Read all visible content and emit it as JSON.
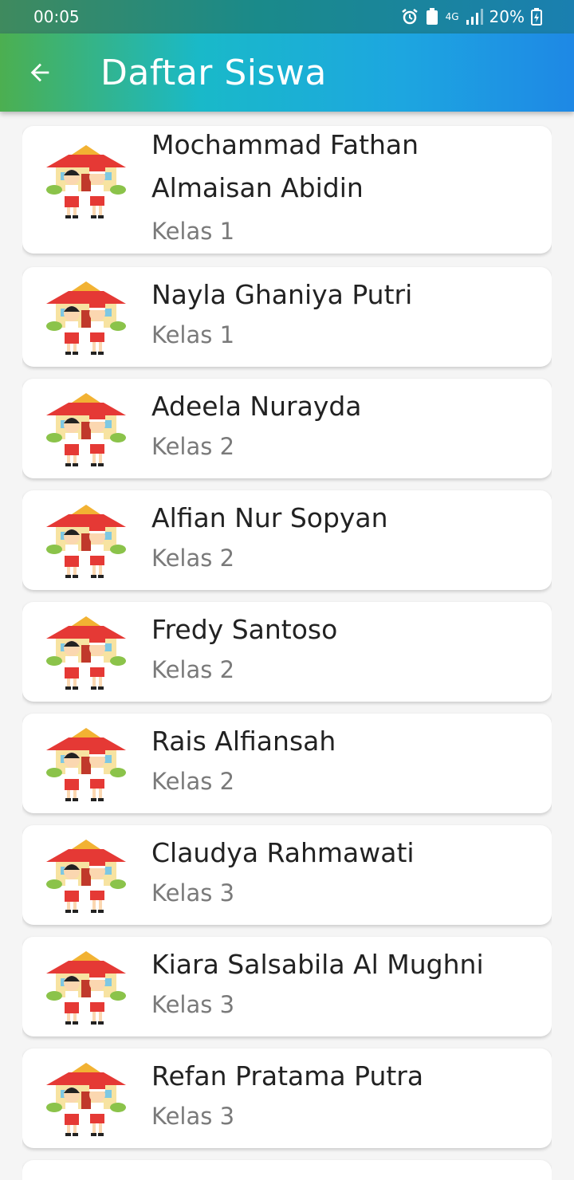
{
  "status_bar": {
    "time": "00:05",
    "network": "4G",
    "battery": "20%"
  },
  "app_bar": {
    "title": "Daftar Siswa",
    "back_icon": "arrow-back-icon"
  },
  "students": [
    {
      "name": "Mochammad Fathan Almaisan Abidin",
      "kelas": "Kelas 1"
    },
    {
      "name": "Nayla Ghaniya Putri",
      "kelas": "Kelas 1"
    },
    {
      "name": "Adeela Nurayda",
      "kelas": "Kelas 2"
    },
    {
      "name": "Alfian Nur Sopyan",
      "kelas": "Kelas 2"
    },
    {
      "name": "Fredy Santoso",
      "kelas": "Kelas 2"
    },
    {
      "name": "Rais Alfiansah",
      "kelas": "Kelas 2"
    },
    {
      "name": "Claudya Rahmawati",
      "kelas": "Kelas 3"
    },
    {
      "name": "Kiara Salsabila Al Mughni",
      "kelas": "Kelas 3"
    },
    {
      "name": "Refan Pratama Putra",
      "kelas": "Kelas 3"
    }
  ],
  "colors": {
    "appbar_start": "#4caf50",
    "appbar_end": "#1e88e5"
  }
}
